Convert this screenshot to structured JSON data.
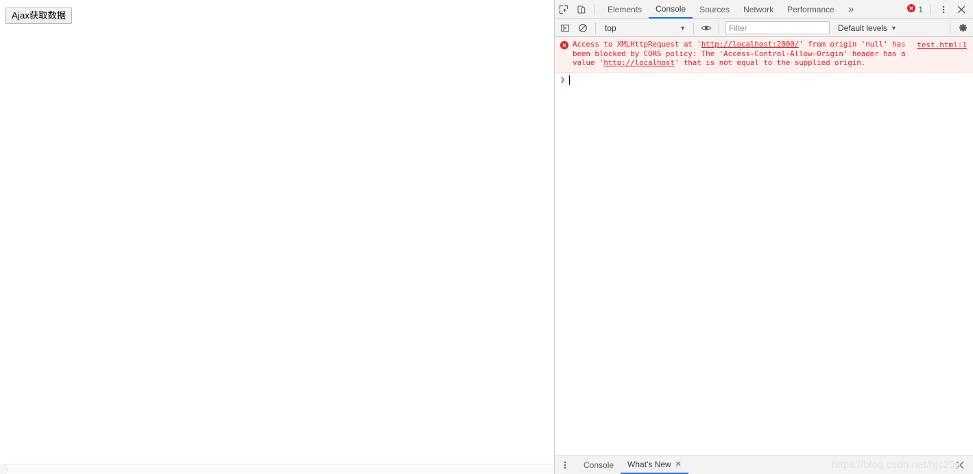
{
  "page": {
    "button_label": "Ajax获取数据",
    "background_color": "#ffffff"
  },
  "devtools": {
    "tabbar": {
      "inspect_icon": "inspect-element-icon",
      "device_icon": "device-toolbar-icon",
      "tabs": [
        {
          "label": "Elements",
          "active": false
        },
        {
          "label": "Console",
          "active": true
        },
        {
          "label": "Sources",
          "active": false
        },
        {
          "label": "Network",
          "active": false
        },
        {
          "label": "Performance",
          "active": false
        }
      ],
      "more_tabs_label": "»",
      "error_count": "1",
      "menu_icon": "kebab-menu-icon",
      "close_icon": "close-icon",
      "active_tab_color": "#1a73e8",
      "error_color": "#e02020"
    },
    "console_toolbar": {
      "sidebar_toggle_icon": "console-sidebar-icon",
      "clear_icon": "clear-console-icon",
      "context_value": "top",
      "context_caret": "▼",
      "eye_icon": "live-expression-eye-icon",
      "filter_placeholder": "Filter",
      "filter_value": "",
      "levels_label": "Default levels",
      "levels_caret": "▼",
      "settings_icon": "gear-icon"
    },
    "console_output": {
      "error": {
        "icon": "error-circle-icon",
        "text_parts": [
          {
            "t": "Access to XMLHttpRequest at '",
            "u": false
          },
          {
            "t": "http://localhost:2000/",
            "u": true
          },
          {
            "t": "' from origin 'null' has been blocked by CORS policy: The 'Access-Control-Allow-Origin' header has a value '",
            "u": false
          },
          {
            "t": "http://localhost",
            "u": true
          },
          {
            "t": "' that is not equal to the supplied origin.",
            "u": false
          }
        ],
        "full_text": "Access to XMLHttpRequest at 'http://localhost:2000/' from origin 'null' has been blocked by CORS policy: The 'Access-Control-Allow-Origin' header has a value 'http://localhost' that is not equal to the supplied origin.",
        "source": "test.html:1",
        "background_color": "#fff0f0"
      },
      "prompt_arrow": "❯",
      "prompt_value": ""
    },
    "drawer": {
      "menu_icon": "kebab-menu-icon",
      "tabs": [
        {
          "label": "Console",
          "active": false,
          "closable": false
        },
        {
          "label": "What's New",
          "active": true,
          "closable": true
        }
      ],
      "tab_close_glyph": "✕",
      "close_icon": "close-icon"
    }
  },
  "watermark": {
    "text": "https://blog.csdn.net/hjc256"
  }
}
